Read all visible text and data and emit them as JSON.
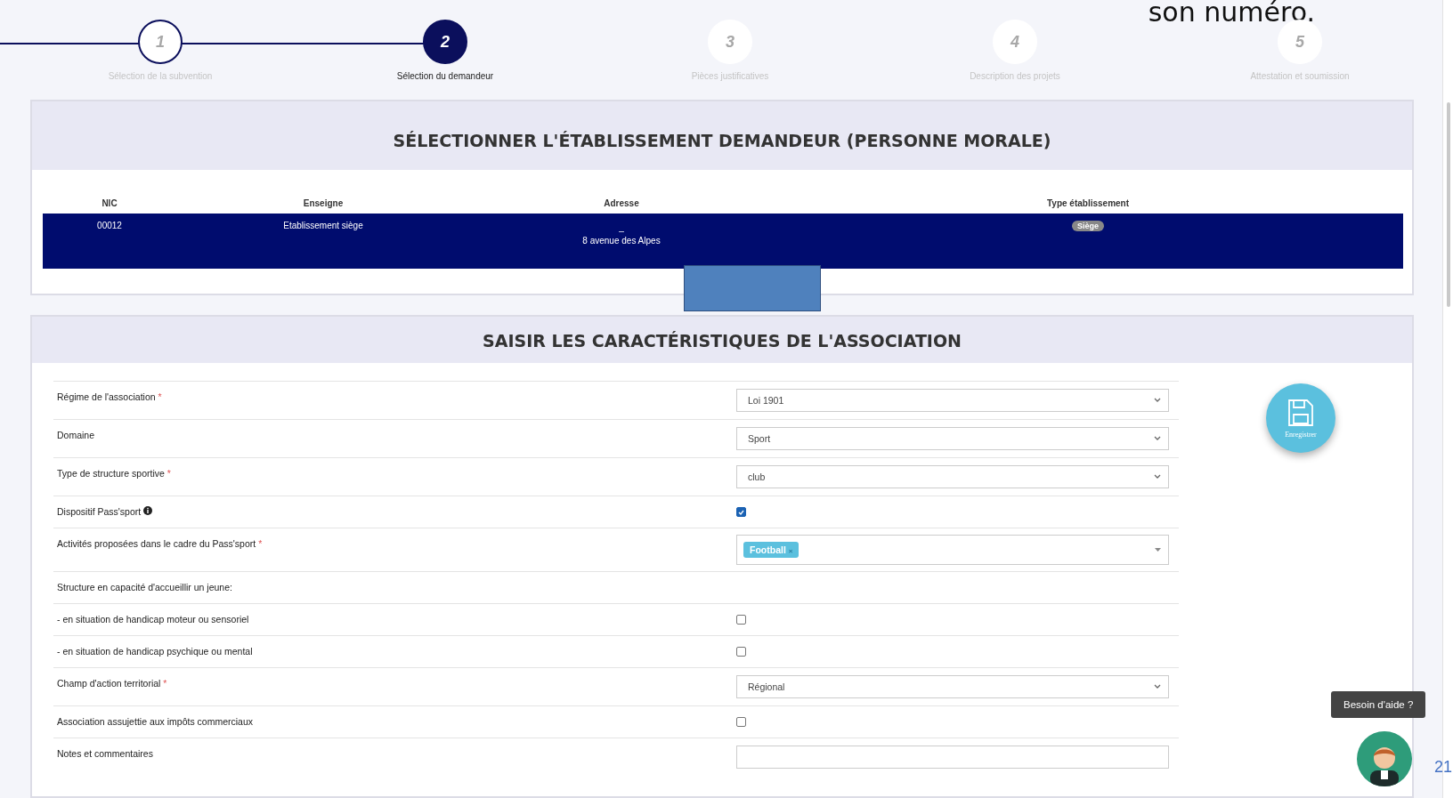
{
  "slide_caption": "son numéro.",
  "steps": [
    {
      "number": "1",
      "label": "Sélection de la subvention",
      "completed": true,
      "selected": false
    },
    {
      "number": "2",
      "label": "Sélection du demandeur",
      "completed": true,
      "selected": true
    },
    {
      "number": "3",
      "label": "Pièces justificatives",
      "completed": false,
      "selected": false
    },
    {
      "number": "4",
      "label": "Description des projets",
      "completed": false,
      "selected": false
    },
    {
      "number": "5",
      "label": "Attestation et soumission",
      "completed": false,
      "selected": false
    }
  ],
  "establishment_panel": {
    "title": "SÉLECTIONNER L'ÉTABLISSEMENT DEMANDEUR (PERSONNE MORALE)",
    "columns": [
      "NIC",
      "Enseigne",
      "Adresse",
      "Type établissement"
    ],
    "rows": [
      {
        "nic": "00012",
        "enseigne": "Etablissement siège",
        "address_lines": [
          "_",
          "8 avenue des Alpes"
        ],
        "type_badge": "Siège",
        "selected": true
      }
    ]
  },
  "association_panel": {
    "title": "SAISIR LES CARACTÉRISTIQUES DE L'ASSOCIATION",
    "fields": [
      {
        "kind": "select",
        "label": "Régime de l'association",
        "required_mark": "*",
        "value": "Loi 1901"
      },
      {
        "kind": "select",
        "label": "Domaine",
        "value": "Sport"
      },
      {
        "kind": "select",
        "label": "Type de structure sportive",
        "required_mark": "*",
        "value": "club"
      },
      {
        "kind": "checkbox",
        "label": "Dispositif Pass'sport",
        "info": true,
        "checked": true
      },
      {
        "kind": "tags",
        "label": "Activités proposées dans le cadre du Pass'sport",
        "required_mark": "*",
        "tags": [
          {
            "label": "Football",
            "remove": "×"
          }
        ]
      },
      {
        "kind": "heading",
        "label": "Structure en capacité d'accueillir un jeune:"
      },
      {
        "kind": "checkbox",
        "label": "- en situation de handicap moteur ou sensoriel",
        "checked": false
      },
      {
        "kind": "checkbox",
        "label": "- en situation de handicap psychique ou mental",
        "checked": false
      },
      {
        "kind": "select",
        "label": "Champ d'action territorial",
        "required_mark": "*",
        "value": "Régional"
      },
      {
        "kind": "checkbox",
        "label": "Association assujettie aux impôts commerciaux",
        "checked": false
      },
      {
        "kind": "text",
        "label": "Notes et commentaires"
      }
    ],
    "save_button": "Enregistrer"
  },
  "help": {
    "tooltip": "Besoin d'aide ?"
  },
  "slide_number": "21"
}
